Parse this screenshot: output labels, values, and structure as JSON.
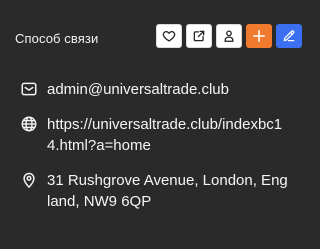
{
  "section": {
    "title": "Способ связи"
  },
  "actions": [
    {
      "name": "favorite",
      "icon": "heart-icon"
    },
    {
      "name": "share",
      "icon": "share-icon"
    },
    {
      "name": "person",
      "icon": "person-icon"
    },
    {
      "name": "add",
      "icon": "plus-icon",
      "color": "#f07a2e"
    },
    {
      "name": "edit",
      "icon": "pencil-icon",
      "color": "#3b6ff2"
    }
  ],
  "contact": {
    "email": "admin@universaltrade.club",
    "website": "https://universaltrade.club/indexbc14.html?a=home",
    "address": "31 Rushgrove Avenue, London, England, NW9 6QP"
  },
  "colors": {
    "background": "#2a2a2a",
    "accent_orange": "#f07a2e",
    "accent_blue": "#3b6ff2"
  }
}
